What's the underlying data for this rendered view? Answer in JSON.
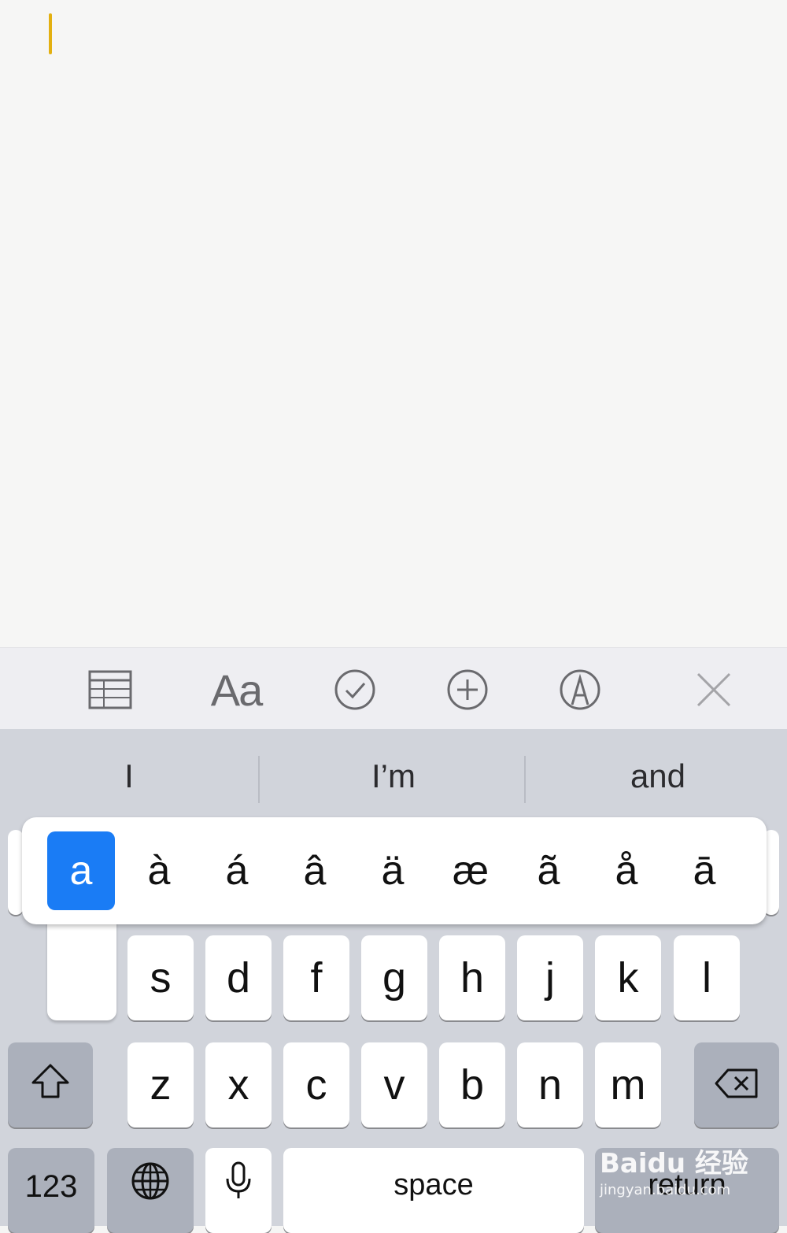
{
  "toolbar": {
    "format_label": "Aa",
    "icons": [
      "table-icon",
      "checklist-icon",
      "add-icon",
      "markup-icon",
      "close-icon"
    ]
  },
  "suggestions": [
    "I",
    "I’m",
    "and"
  ],
  "accent_popup": {
    "selected": "a",
    "options": [
      "à",
      "á",
      "â",
      "ä",
      "æ",
      "ã",
      "å",
      "ā"
    ]
  },
  "keys": {
    "row2": [
      "s",
      "d",
      "f",
      "g",
      "h",
      "j",
      "k",
      "l"
    ],
    "row3": [
      "z",
      "x",
      "c",
      "v",
      "b",
      "n",
      "m"
    ],
    "numbers_label": "123",
    "space_label": "space",
    "return_label": "return"
  },
  "watermark": {
    "brand": "Baidu 经验",
    "url": "jingyan.baidu.com"
  },
  "colors": {
    "cursor": "#e3b010",
    "accent_selected": "#1a7cf5",
    "keyboard_bg": "#d1d4db"
  }
}
